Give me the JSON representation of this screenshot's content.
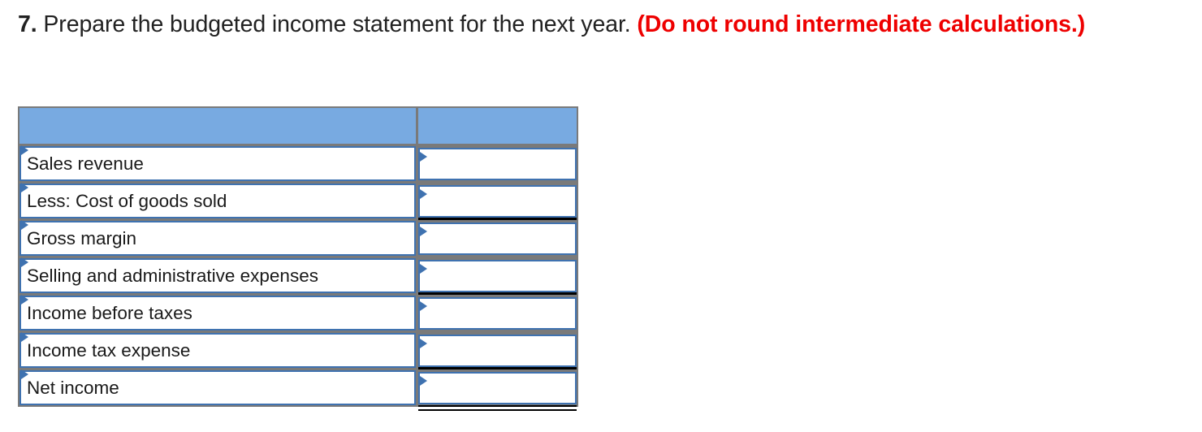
{
  "question": {
    "number": "7.",
    "text": " Prepare the budgeted income statement for the next year. ",
    "note": "(Do not round intermediate calculations.)"
  },
  "colors": {
    "header_fill": "#78aae1",
    "cell_border": "#3f72b0",
    "grid": "#7a7a7a",
    "note_red": "#ee0000"
  },
  "table": {
    "header": {
      "label": "",
      "value": ""
    },
    "rows": [
      {
        "label": "Sales revenue",
        "value": "",
        "underline": "none"
      },
      {
        "label": "Less: Cost of goods sold",
        "value": "",
        "underline": "single"
      },
      {
        "label": "Gross margin",
        "value": "",
        "underline": "none"
      },
      {
        "label": "Selling and administrative expenses",
        "value": "",
        "underline": "single"
      },
      {
        "label": "Income before taxes",
        "value": "",
        "underline": "none"
      },
      {
        "label": "Income tax expense",
        "value": "",
        "underline": "single"
      },
      {
        "label": "Net income",
        "value": "",
        "underline": "double"
      }
    ]
  }
}
